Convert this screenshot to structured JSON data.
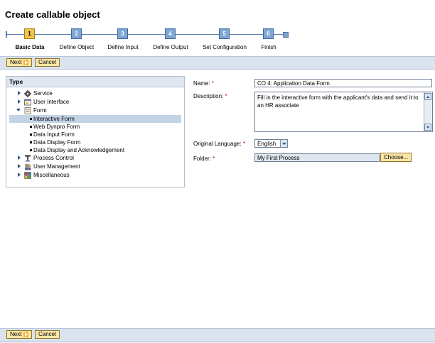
{
  "page": {
    "title": "Create callable object"
  },
  "roadmap": {
    "steps": [
      {
        "number": "1",
        "label": "Basic Data",
        "active": true
      },
      {
        "number": "2",
        "label": "Define Object",
        "active": false
      },
      {
        "number": "3",
        "label": "Define Input",
        "active": false
      },
      {
        "number": "4",
        "label": "Define Output",
        "active": false
      },
      {
        "number": "5",
        "label": "Set Configuration",
        "active": false
      },
      {
        "number": "6",
        "label": "Finish",
        "active": false
      }
    ]
  },
  "toolbar_top": {
    "next_label": "Next",
    "cancel_label": "Cancel"
  },
  "toolbar_bottom": {
    "next_label": "Next",
    "cancel_label": "Cancel"
  },
  "type_panel": {
    "header": "Type",
    "items": [
      {
        "label": "Service",
        "icon": "gear-icon",
        "expanded": false
      },
      {
        "label": "User Interface",
        "icon": "window-icon",
        "expanded": false
      },
      {
        "label": "Form",
        "icon": "form-icon",
        "expanded": true
      },
      {
        "label": "Interactive Form",
        "selected": true
      },
      {
        "label": "Web Dynpro Form"
      },
      {
        "label": "Data Input Form"
      },
      {
        "label": "Data Display Form"
      },
      {
        "label": "Data Display and Acknowledgement"
      },
      {
        "label": "Process Control",
        "icon": "process-control-icon",
        "expanded": false
      },
      {
        "label": "User Management",
        "icon": "user-management-icon",
        "expanded": false
      },
      {
        "label": "Miscellaneous",
        "icon": "miscellaneous-icon",
        "expanded": false
      }
    ]
  },
  "form": {
    "required_marker": "*",
    "name_label": "Name:",
    "name_value": "CO 4: Application Data Form",
    "description_label": "Description:",
    "description_value": "Fill in the interactive form with the applicant's data and send it to an HR associate",
    "language_label": "Original Language:",
    "language_value": "English",
    "folder_label": "Folder:",
    "folder_value": "My First Process",
    "choose_label": "Choose..."
  },
  "colors": {
    "toolbar_bg": "#dbe3ee",
    "button_bg": "#f9e6a7",
    "active_step": "#f1c44d",
    "step": "#7ea6d3",
    "required": "#c00000"
  }
}
